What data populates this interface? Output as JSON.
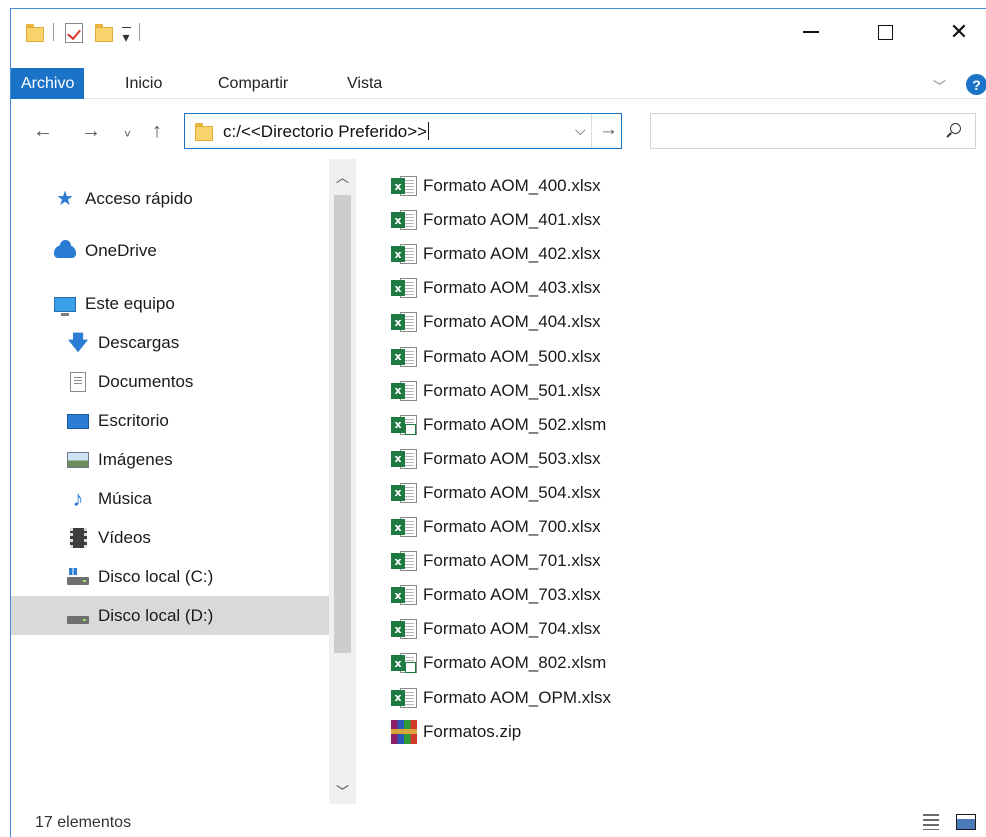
{
  "window": {
    "controls": {
      "minimize": "",
      "maximize": "",
      "close": "✕"
    }
  },
  "ribbon": {
    "tabs": [
      "Archivo",
      "Inicio",
      "Compartir",
      "Vista"
    ],
    "active_color": "#1a73c6",
    "help_label": "?"
  },
  "address_bar": {
    "value": "c:/<<Directorio Preferido>>",
    "search_placeholder": ""
  },
  "nav_buttons": {
    "back": "←",
    "forward": "→",
    "recent": "˅",
    "up": "↑",
    "dropdown": "⌵",
    "go": "→"
  },
  "nav_pane": {
    "items": [
      {
        "label": "Acceso rápido",
        "icon": "star-icon"
      },
      {
        "label": "OneDrive",
        "icon": "cloud-icon"
      },
      {
        "label": "Este equipo",
        "icon": "computer-icon"
      },
      {
        "label": "Descargas",
        "icon": "download-icon"
      },
      {
        "label": "Documentos",
        "icon": "documents-icon"
      },
      {
        "label": "Escritorio",
        "icon": "desktop-icon"
      },
      {
        "label": "Imágenes",
        "icon": "pictures-icon"
      },
      {
        "label": "Música",
        "icon": "music-icon"
      },
      {
        "label": "Vídeos",
        "icon": "videos-icon"
      },
      {
        "label": "Disco local (C:)",
        "icon": "drive-c-icon"
      },
      {
        "label": "Disco local (D:)",
        "icon": "drive-d-icon",
        "selected": true
      }
    ]
  },
  "files": [
    {
      "name": "Formato AOM_400.xlsx",
      "icon": "excel-file-icon"
    },
    {
      "name": "Formato AOM_401.xlsx",
      "icon": "excel-file-icon"
    },
    {
      "name": "Formato AOM_402.xlsx",
      "icon": "excel-file-icon"
    },
    {
      "name": "Formato AOM_403.xlsx",
      "icon": "excel-file-icon"
    },
    {
      "name": "Formato AOM_404.xlsx",
      "icon": "excel-file-icon"
    },
    {
      "name": "Formato AOM_500.xlsx",
      "icon": "excel-file-icon"
    },
    {
      "name": "Formato AOM_501.xlsx",
      "icon": "excel-file-icon"
    },
    {
      "name": "Formato AOM_502.xlsm",
      "icon": "excel-macro-file-icon"
    },
    {
      "name": "Formato AOM_503.xlsx",
      "icon": "excel-file-icon"
    },
    {
      "name": "Formato AOM_504.xlsx",
      "icon": "excel-file-icon"
    },
    {
      "name": "Formato AOM_700.xlsx",
      "icon": "excel-file-icon"
    },
    {
      "name": "Formato AOM_701.xlsx",
      "icon": "excel-file-icon"
    },
    {
      "name": "Formato AOM_703.xlsx",
      "icon": "excel-file-icon"
    },
    {
      "name": "Formato AOM_704.xlsx",
      "icon": "excel-file-icon"
    },
    {
      "name": "Formato AOM_802.xlsm",
      "icon": "excel-macro-file-icon"
    },
    {
      "name": "Formato AOM_OPM.xlsx",
      "icon": "excel-file-icon"
    },
    {
      "name": "Formatos.zip",
      "icon": "zip-archive-icon"
    }
  ],
  "status_bar": {
    "item_count": "17 elementos"
  }
}
